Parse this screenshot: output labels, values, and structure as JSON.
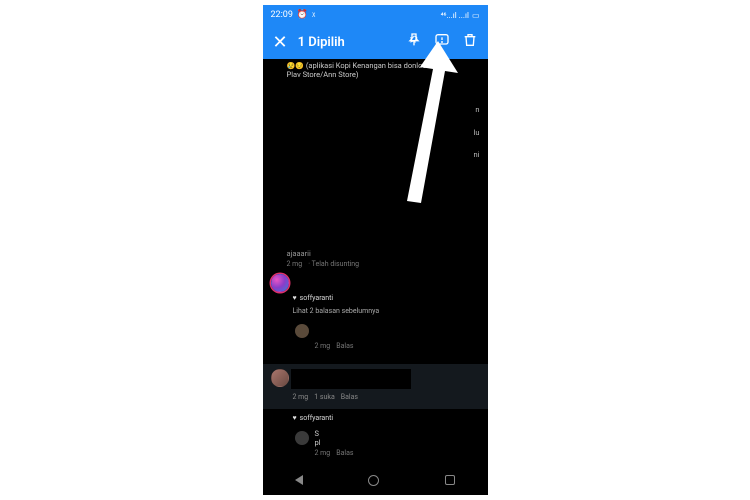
{
  "status": {
    "time": "22:09",
    "alarm_icon": "⏰",
    "walk_icon": "🚶",
    "signal_label": "⁴⁶...ıl ...ıl",
    "battery": "81"
  },
  "selection_bar": {
    "title": "1 Dipilih"
  },
  "partial_top_comment": {
    "emoji": "😢😔",
    "text_line1": "(aplikasi Kopi Kenangan bisa donlod",
    "text_line2": "Plav Store/Ann Store)"
  },
  "right_fragments": {
    "f1": "n",
    "f2": "lu",
    "f3": "ni"
  },
  "comment1": {
    "text": "ajaaarii",
    "age": "2 mg",
    "edited": "· Telah disunting"
  },
  "like1": {
    "user": "soffyaranti"
  },
  "view_replies": "Lihat 2 balasan sebelumnya",
  "reply1": {
    "age": "2 mg",
    "action": "Balas"
  },
  "selected": {
    "age": "2 mg",
    "likes": "1 suka",
    "action": "Balas"
  },
  "like2": {
    "user": "soffyaranti"
  },
  "reply2": {
    "text1": "S",
    "text2": "pl",
    "age": "2 mg",
    "action": "Balas"
  }
}
